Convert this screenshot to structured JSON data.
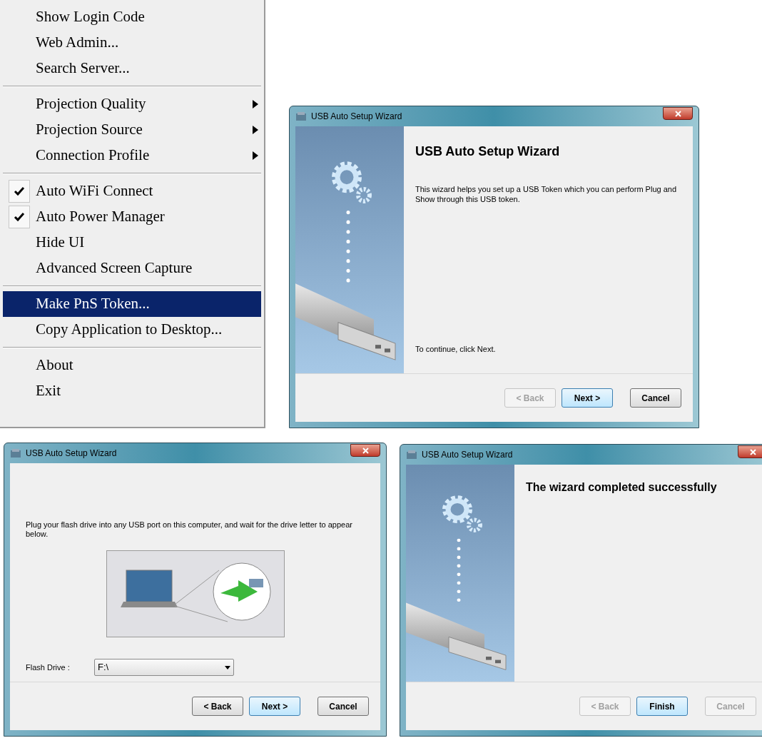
{
  "menu": {
    "items": [
      {
        "kind": "item",
        "label": "Show Login Code",
        "checked": false,
        "selected": false,
        "submenu": false
      },
      {
        "kind": "item",
        "label": "Web Admin...",
        "checked": false,
        "selected": false,
        "submenu": false
      },
      {
        "kind": "item",
        "label": "Search Server...",
        "checked": false,
        "selected": false,
        "submenu": false
      },
      {
        "kind": "separator"
      },
      {
        "kind": "item",
        "label": "Projection Quality",
        "checked": false,
        "selected": false,
        "submenu": true
      },
      {
        "kind": "item",
        "label": "Projection Source",
        "checked": false,
        "selected": false,
        "submenu": true
      },
      {
        "kind": "item",
        "label": "Connection Profile",
        "checked": false,
        "selected": false,
        "submenu": true
      },
      {
        "kind": "separator"
      },
      {
        "kind": "item",
        "label": "Auto WiFi Connect",
        "checked": true,
        "selected": false,
        "submenu": false
      },
      {
        "kind": "item",
        "label": "Auto Power Manager",
        "checked": true,
        "selected": false,
        "submenu": false
      },
      {
        "kind": "item",
        "label": "Hide UI",
        "checked": false,
        "selected": false,
        "submenu": false
      },
      {
        "kind": "item",
        "label": "Advanced Screen Capture",
        "checked": false,
        "selected": false,
        "submenu": false
      },
      {
        "kind": "separator"
      },
      {
        "kind": "item",
        "label": "Make PnS Token...",
        "checked": false,
        "selected": true,
        "submenu": false
      },
      {
        "kind": "item",
        "label": "Copy Application to Desktop...",
        "checked": false,
        "selected": false,
        "submenu": false
      },
      {
        "kind": "separator"
      },
      {
        "kind": "item",
        "label": "About",
        "checked": false,
        "selected": false,
        "submenu": false
      },
      {
        "kind": "item",
        "label": "Exit",
        "checked": false,
        "selected": false,
        "submenu": false
      }
    ]
  },
  "wizards": [
    {
      "kind": "welcome",
      "title": "USB Auto Setup Wizard",
      "heading": "USB Auto Setup Wizard",
      "text": "This wizard helps you set up a USB Token which you can perform Plug and Show through this USB token.",
      "footer_text": "To continue, click Next.",
      "buttons": [
        {
          "label": "< Back",
          "disabled": true,
          "default": false
        },
        {
          "label": "Next >",
          "disabled": false,
          "default": true
        },
        {
          "label": "Cancel",
          "disabled": false,
          "default": false
        }
      ]
    },
    {
      "kind": "plug",
      "title": "USB Auto Setup Wizard",
      "text": "Plug your flash drive into any USB port on this computer, and wait for the drive letter to appear below.",
      "drive_label": "Flash Drive :",
      "drive_value": "F:\\",
      "buttons": [
        {
          "label": "< Back",
          "disabled": false,
          "default": false
        },
        {
          "label": "Next >",
          "disabled": false,
          "default": true
        },
        {
          "label": "Cancel",
          "disabled": false,
          "default": false
        }
      ]
    },
    {
      "kind": "finish",
      "title": "USB Auto Setup Wizard",
      "heading": "The wizard completed successfully",
      "buttons": [
        {
          "label": "< Back",
          "disabled": true,
          "default": false
        },
        {
          "label": "Finish",
          "disabled": false,
          "default": true
        },
        {
          "label": "Cancel",
          "disabled": true,
          "default": false
        }
      ]
    }
  ]
}
